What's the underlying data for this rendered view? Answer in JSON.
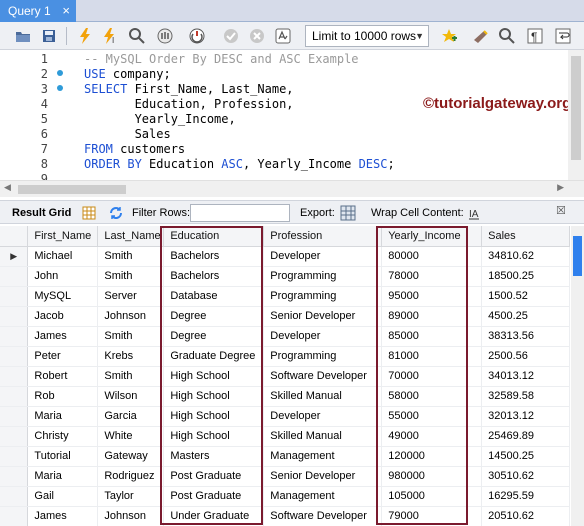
{
  "tab": {
    "title": "Query 1",
    "close": "×"
  },
  "toolbar": {
    "limit_label": "Limit to 10000 rows",
    "icons": [
      "folder-open-icon",
      "save-icon",
      "execute-icon",
      "execute-current-icon",
      "explain-icon",
      "stop-icon",
      "toggle-continue-icon",
      "commit-icon",
      "rollback-icon",
      "autocommit-icon",
      "limit-dropdown",
      "beautify-icon",
      "find-icon",
      "invisibles-icon",
      "wrap-icon"
    ]
  },
  "editor": {
    "line_numbers": [
      "1",
      "2",
      "3",
      "4",
      "5",
      "6",
      "7",
      "8",
      "9"
    ],
    "lines": [
      [
        {
          "t": "-- MySQL Order By DESC and ASC Example",
          "c": "cm"
        }
      ],
      [
        {
          "t": "USE",
          "c": "kw"
        },
        {
          "t": " company;",
          "c": "id"
        }
      ],
      [
        {
          "t": "SELECT",
          "c": "kw"
        },
        {
          "t": " First_Name, Last_Name,",
          "c": "id"
        }
      ],
      [
        {
          "t": "       Education, Profession,",
          "c": "id"
        }
      ],
      [
        {
          "t": "       Yearly_Income,",
          "c": "id"
        }
      ],
      [
        {
          "t": "       Sales",
          "c": "id"
        }
      ],
      [
        {
          "t": "FROM",
          "c": "kw"
        },
        {
          "t": " customers",
          "c": "id"
        }
      ],
      [
        {
          "t": "ORDER BY",
          "c": "kw"
        },
        {
          "t": " Education ",
          "c": "id"
        },
        {
          "t": "ASC",
          "c": "kw"
        },
        {
          "t": ", Yearly_Income ",
          "c": "id"
        },
        {
          "t": "DESC",
          "c": "kw"
        },
        {
          "t": ";",
          "c": "id"
        }
      ],
      [
        {
          "t": "",
          "c": "id"
        }
      ]
    ],
    "watermark": "©tutorialgateway.org"
  },
  "result_toolbar": {
    "result_grid": "Result Grid",
    "filter_rows": "Filter Rows:",
    "filter_value": "",
    "export": "Export:",
    "wrap": "Wrap Cell Content:"
  },
  "grid": {
    "columns": [
      "First_Name",
      "Last_Name",
      "Education",
      "Profession",
      "Yearly_Income",
      "Sales"
    ],
    "rows": [
      [
        "Michael",
        "Smith",
        "Bachelors",
        "Developer",
        "80000",
        "34810.62"
      ],
      [
        "John",
        "Smith",
        "Bachelors",
        "Programming",
        "78000",
        "18500.25"
      ],
      [
        "MySQL",
        "Server",
        "Database",
        "Programming",
        "95000",
        "1500.52"
      ],
      [
        "Jacob",
        "Johnson",
        "Degree",
        "Senior Developer",
        "89000",
        "4500.25"
      ],
      [
        "James",
        "Smith",
        "Degree",
        "Developer",
        "85000",
        "38313.56"
      ],
      [
        "Peter",
        "Krebs",
        "Graduate Degree",
        "Programming",
        "81000",
        "2500.56"
      ],
      [
        "Robert",
        "Smith",
        "High School",
        "Software Developer",
        "70000",
        "34013.12"
      ],
      [
        "Rob",
        "Wilson",
        "High School",
        "Skilled Manual",
        "58000",
        "32589.58"
      ],
      [
        "Maria",
        "Garcia",
        "High School",
        "Developer",
        "55000",
        "32013.12"
      ],
      [
        "Christy",
        "White",
        "High School",
        "Skilled Manual",
        "49000",
        "25469.89"
      ],
      [
        "Tutorial",
        "Gateway",
        "Masters",
        "Management",
        "120000",
        "14500.25"
      ],
      [
        "Maria",
        "Rodriguez",
        "Post Graduate",
        "Senior Developer",
        "980000",
        "30510.62"
      ],
      [
        "Gail",
        "Taylor",
        "Post Graduate",
        "Management",
        "105000",
        "16295.59"
      ],
      [
        "James",
        "Johnson",
        "Under Graduate",
        "Software Developer",
        "79000",
        "20510.62"
      ]
    ],
    "selected_row_marker": "▶",
    "highlighted_columns": [
      "Education",
      "Yearly_Income"
    ]
  },
  "colors": {
    "tab": "#4a90e2",
    "keyword": "#1d4fd3",
    "comment": "#9a9a9a",
    "highlight": "#7a1a2e",
    "watermark": "#8b1a1a"
  }
}
